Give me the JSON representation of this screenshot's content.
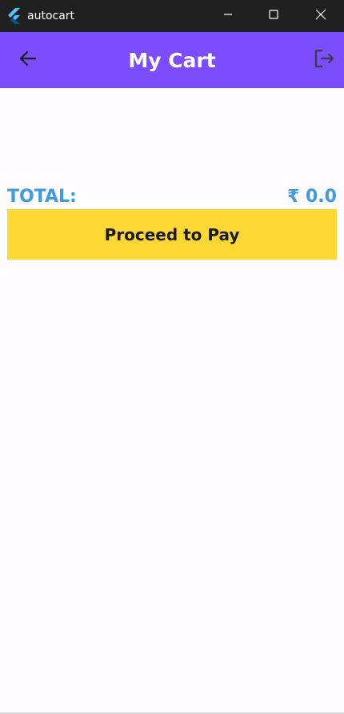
{
  "window": {
    "app_name": "autocart",
    "controls": {
      "minimize_icon": "minimize-icon",
      "maximize_icon": "maximize-icon",
      "close_icon": "close-icon"
    }
  },
  "appbar": {
    "title": "My Cart",
    "back_icon": "arrow-back-icon",
    "logout_icon": "logout-icon",
    "background_color": "#7c4dff"
  },
  "cart": {
    "total_label": "TOTAL:",
    "total_value": "₹ 0.0",
    "accent_color": "#3d9be3"
  },
  "actions": {
    "pay_label": "Proceed to Pay",
    "pay_color": "#fdd835"
  }
}
